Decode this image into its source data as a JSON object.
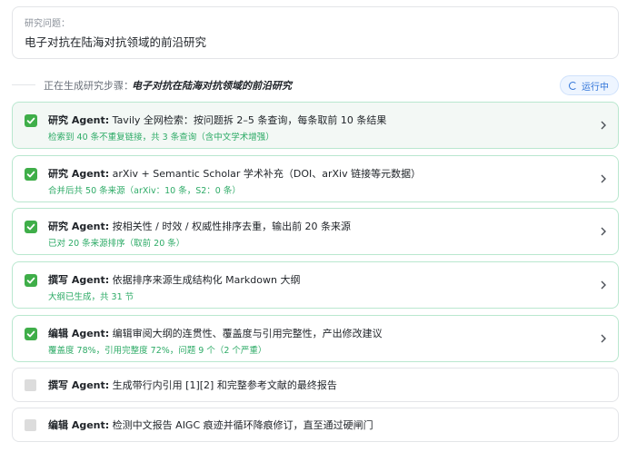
{
  "question": {
    "label": "研究问题：",
    "text": "电子对抗在陆海对抗领域的前沿研究"
  },
  "generation": {
    "prefix": "正在生成研究步骤：",
    "title": "电子对抗在陆海对抗领域的前沿研究",
    "status": "运行中",
    "status_color": "#2f73d8"
  },
  "steps": [
    {
      "agent": "研究 Agent:",
      "title": " Tavily 全网检索：按问题拆 2–5 条查询，每条取前 10 条结果",
      "detail": "检索到 40 条不重复链接，共 3 条查询（含中文学术增强）",
      "status": "done",
      "icon": "check-icon"
    },
    {
      "agent": "研究 Agent:",
      "title": " arXiv + Semantic Scholar 学术补充（DOI、arXiv 链接等元数据）",
      "detail": "合并后共 50 条来源（arXiv：10 条，S2：0 条）",
      "status": "done",
      "icon": "check-icon"
    },
    {
      "agent": "研究 Agent:",
      "title": " 按相关性 / 时效 / 权威性排序去重，输出前 20 条来源",
      "detail": "已对 20 条来源排序（取前 20 条）",
      "status": "done",
      "icon": "check-icon"
    },
    {
      "agent": "撰写 Agent:",
      "title": " 依据排序来源生成结构化 Markdown 大纲",
      "detail": "大纲已生成，共 31 节",
      "status": "done",
      "icon": "check-icon"
    },
    {
      "agent": "编辑 Agent:",
      "title": " 编辑审阅大纲的连贯性、覆盖度与引用完整性，产出修改建议",
      "detail": "覆盖度 78%，引用完整度 72%，问题 9 个（2 个严重）",
      "status": "done",
      "icon": "check-icon"
    },
    {
      "agent": "撰写 Agent:",
      "title": " 生成带行内引用 [1][2] 和完整参考文献的最终报告",
      "detail": "",
      "status": "pending",
      "icon": "pending-icon"
    },
    {
      "agent": "编辑 Agent:",
      "title": " 检测中文报告 AIGC 痕迹并循环降痕修订，直至通过硬闸门",
      "detail": "",
      "status": "pending",
      "icon": "pending-icon"
    }
  ],
  "colors": {
    "success": "#3fae49",
    "detail_text": "#2eab67",
    "accent": "#2f73d8"
  }
}
